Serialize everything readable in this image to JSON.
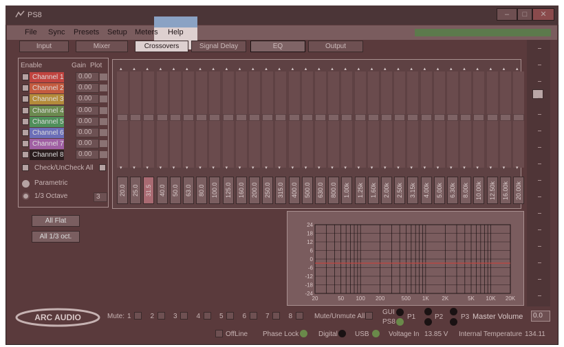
{
  "window": {
    "title": "PS8",
    "min": "–",
    "max": "□",
    "close": "✕"
  },
  "menu": [
    "File",
    "Sync",
    "Presets",
    "Setup",
    "Meters",
    "Help"
  ],
  "tabs": [
    "Input",
    "Mixer",
    "Crossovers",
    "Signal Delay",
    "EQ",
    "Output"
  ],
  "left_panel": {
    "enable_label": "Enable",
    "gain_label": "Gain",
    "plot_label": "Plot",
    "channels": [
      {
        "name": "Channel 1",
        "gain": "0.00",
        "color": "#c0443f",
        "checked": true
      },
      {
        "name": "Channel 2",
        "gain": "0.00",
        "color": "#c45b3f",
        "checked": false
      },
      {
        "name": "Channel 3",
        "gain": "0.00",
        "color": "#b48b3a",
        "checked": false
      },
      {
        "name": "Channel 4",
        "gain": "0.00",
        "color": "#6b8a4f",
        "checked": false
      },
      {
        "name": "Channel 5",
        "gain": "0.00",
        "color": "#4f8f5a",
        "checked": false
      },
      {
        "name": "Channel 6",
        "gain": "0.00",
        "color": "#6b6eb8",
        "checked": false
      },
      {
        "name": "Channel 7",
        "gain": "0.00",
        "color": "#a05fa3",
        "checked": false
      },
      {
        "name": "Channel 8",
        "gain": "0.00",
        "color": "#2a1d1e",
        "checked": false
      }
    ],
    "check_all": "Check/UnCheck All",
    "parametric": "Parametric",
    "third_octave": "1/3 Octave",
    "octave_value": "3"
  },
  "buttons": {
    "all_flat": "All Flat",
    "all_third": "All 1/3 oct."
  },
  "eq": {
    "frequencies": [
      "20.0",
      "25.0",
      "31.5",
      "40.0",
      "50.0",
      "63.0",
      "80.0",
      "100.0",
      "125.0",
      "160.0",
      "200.0",
      "250.0",
      "315.0",
      "400.0",
      "500.0",
      "630.0",
      "800.0",
      "1.00k",
      "1.25k",
      "1.60k",
      "2.00k",
      "2.50k",
      "3.15k",
      "4.00k",
      "5.00k",
      "6.30k",
      "8.00k",
      "10.00k",
      "12.50k",
      "16.00k",
      "20.00k"
    ],
    "selected_index": 2
  },
  "graph": {
    "y_ticks": [
      "24",
      "18",
      "12",
      "6",
      "0",
      "-6",
      "-12",
      "-18",
      "-24"
    ],
    "x_ticks": [
      "20",
      "50",
      "100",
      "200",
      "500",
      "1K",
      "2K",
      "5K",
      "10K",
      "20K"
    ]
  },
  "bottom": {
    "mute_label": "Mute:",
    "mute_channels": [
      "1",
      "2",
      "3",
      "4",
      "5",
      "6",
      "7",
      "8"
    ],
    "mute_all": "Mute/Unmute All",
    "gui": "GUI",
    "ps8": "PS8",
    "p1": "P1",
    "p2": "P2",
    "p3": "P3",
    "master_volume": "Master Volume",
    "master_value": "0.0",
    "offline": "OffLine",
    "phase_lock": "Phase Lock",
    "digital": "Digital",
    "usb": "USB",
    "voltage_label": "Voltage In",
    "voltage_value": "13.85 V",
    "temp_label": "Internal Temperature",
    "temp_value": "134.11",
    "logo": "ARC AUDIO"
  }
}
